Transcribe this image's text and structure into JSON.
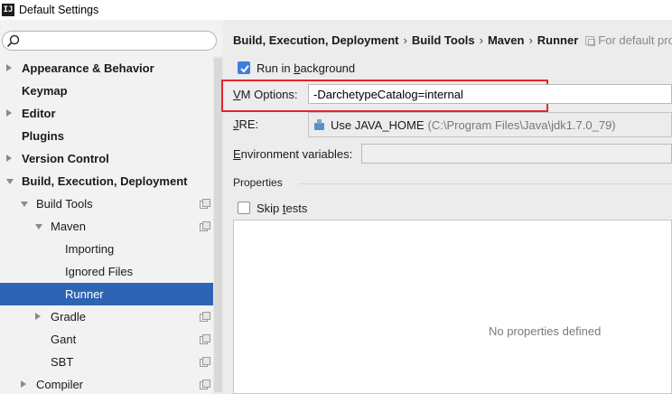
{
  "window": {
    "title": "Default Settings",
    "app_icon_text": "IJ"
  },
  "search": {
    "placeholder": "",
    "value": ""
  },
  "sidebar": {
    "items": [
      {
        "label": "Appearance & Behavior",
        "bold": true,
        "indent": 0,
        "arrow": "right",
        "icon": false,
        "selected": false
      },
      {
        "label": "Keymap",
        "bold": true,
        "indent": 0,
        "arrow": "none",
        "icon": false,
        "selected": false
      },
      {
        "label": "Editor",
        "bold": true,
        "indent": 0,
        "arrow": "right",
        "icon": false,
        "selected": false
      },
      {
        "label": "Plugins",
        "bold": true,
        "indent": 0,
        "arrow": "none",
        "icon": false,
        "selected": false
      },
      {
        "label": "Version Control",
        "bold": true,
        "indent": 0,
        "arrow": "right",
        "icon": false,
        "selected": false
      },
      {
        "label": "Build, Execution, Deployment",
        "bold": true,
        "indent": 0,
        "arrow": "down",
        "icon": false,
        "selected": false
      },
      {
        "label": "Build Tools",
        "bold": false,
        "indent": 1,
        "arrow": "down",
        "icon": true,
        "selected": false
      },
      {
        "label": "Maven",
        "bold": false,
        "indent": 2,
        "arrow": "down",
        "icon": true,
        "selected": false
      },
      {
        "label": "Importing",
        "bold": false,
        "indent": 3,
        "arrow": "none",
        "icon": false,
        "selected": false
      },
      {
        "label": "Ignored Files",
        "bold": false,
        "indent": 3,
        "arrow": "none",
        "icon": false,
        "selected": false
      },
      {
        "label": "Runner",
        "bold": false,
        "indent": 3,
        "arrow": "none",
        "icon": false,
        "selected": true
      },
      {
        "label": "Gradle",
        "bold": false,
        "indent": 2,
        "arrow": "right",
        "icon": true,
        "selected": false
      },
      {
        "label": "Gant",
        "bold": false,
        "indent": 2,
        "arrow": "none",
        "icon": true,
        "selected": false
      },
      {
        "label": "SBT",
        "bold": false,
        "indent": 2,
        "arrow": "none",
        "icon": true,
        "selected": false
      },
      {
        "label": "Compiler",
        "bold": false,
        "indent": 1,
        "arrow": "right",
        "icon": true,
        "selected": false
      }
    ]
  },
  "breadcrumb": {
    "items": [
      "Build, Execution, Deployment",
      "Build Tools",
      "Maven",
      "Runner"
    ],
    "separator": "›",
    "hint": "For default proje"
  },
  "runner": {
    "run_in_background": {
      "pre": "Run in ",
      "mnemonic": "b",
      "post": "ackground",
      "checked": true
    },
    "vm_options": {
      "mnemonic": "V",
      "label_rest": "M Options:",
      "value": "-DarchetypeCatalog=internal"
    },
    "jre": {
      "mnemonic": "J",
      "label_rest": "RE:",
      "value": "Use JAVA_HOME",
      "path": "(C:\\Program Files\\Java\\jdk1.7.0_79)"
    },
    "env_vars": {
      "mnemonic": "E",
      "label_rest": "nvironment variables:",
      "value": ""
    },
    "properties_heading": "Properties",
    "skip_tests": {
      "pre": "Skip ",
      "mnemonic": "t",
      "post": "ests",
      "checked": false
    },
    "empty_text": "No properties defined"
  },
  "colors": {
    "selection": "#2e64b4",
    "highlight_border": "#e8242a",
    "checkbox_checked": "#3f7ce0"
  }
}
